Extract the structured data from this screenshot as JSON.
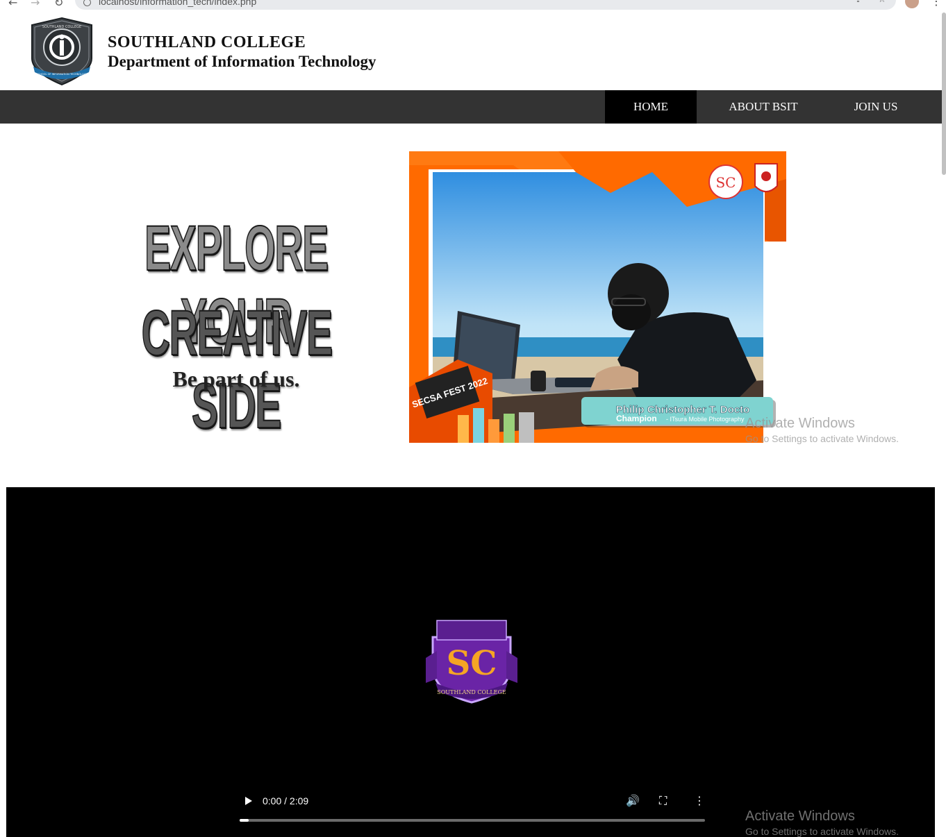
{
  "browser": {
    "url": "localhost/information_tech/index.php",
    "back_icon": "←",
    "forward_icon": "→",
    "reload_icon": "↻",
    "share_icon": "⇪",
    "star_icon": "☆",
    "menu_icon": "⋮"
  },
  "header": {
    "college_name": "SOUTHLAND COLLEGE",
    "department": "Department of Information Technology",
    "logo_text": "SOUTHLAND COLLEGE",
    "logo_subtext": "SCHOOL OF INFORMATION TECHNOLOGY"
  },
  "nav": {
    "items": [
      {
        "label": "HOME",
        "active": true
      },
      {
        "label": "ABOUT BSIT",
        "active": false
      },
      {
        "label": "JOIN US",
        "active": false
      }
    ]
  },
  "hero": {
    "line1": "EXPLORE YOUR",
    "line2": "CREATIVE SIDE",
    "tagline": "Be part of us.",
    "photo": {
      "caption_name": "Philip Christopher T. Docto",
      "caption_award": "Champion",
      "caption_category": "- ITsura Mobile Photography",
      "event": "SECSA FEST 2022"
    }
  },
  "watermark": {
    "title": "Activate Windows",
    "subtitle": "Go to Settings to activate Windows."
  },
  "video": {
    "time": "0:00 / 2:09",
    "progress": 0.02,
    "logo_text": "SOUTHLAND COLLEGE",
    "logo_letters": "SC"
  },
  "colors": {
    "navbar": "#333333",
    "nav_active": "#000000",
    "accent_orange": "#ff6a00",
    "teal_caption": "#7fd3d0",
    "purple_logo": "#7a2fb0"
  }
}
